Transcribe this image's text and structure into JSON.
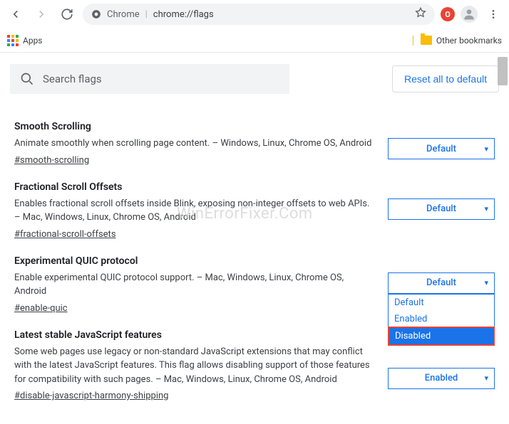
{
  "browser": {
    "omnibox_prefix": "Chrome",
    "omnibox_url": "chrome://flags",
    "apps_label": "Apps",
    "other_bookmarks": "Other bookmarks"
  },
  "header": {
    "search_placeholder": "Search flags",
    "reset_label": "Reset all to default"
  },
  "flags": [
    {
      "title": "Smooth Scrolling",
      "desc": "Animate smoothly when scrolling page content. – Windows, Linux, Chrome OS, Android",
      "hash": "#smooth-scrolling",
      "value": "Default",
      "open": false
    },
    {
      "title": "Fractional Scroll Offsets",
      "desc": "Enables fractional scroll offsets inside Blink, exposing non-integer offsets to web APIs. – Mac, Windows, Linux, Chrome OS, Android",
      "hash": "#fractional-scroll-offsets",
      "value": "Default",
      "open": false
    },
    {
      "title": "Experimental QUIC protocol",
      "desc": "Enable experimental QUIC protocol support. – Mac, Windows, Linux, Chrome OS, Android",
      "hash": "#enable-quic",
      "value": "Default",
      "open": true,
      "options": [
        "Default",
        "Enabled",
        "Disabled"
      ],
      "highlighted": "Disabled"
    },
    {
      "title": "Latest stable JavaScript features",
      "desc": "Some web pages use legacy or non-standard JavaScript extensions that may conflict with the latest JavaScript features. This flag allows disabling support of those features for compatibility with such pages. – Mac, Windows, Linux, Chrome OS, Android",
      "hash": "#disable-javascript-harmony-shipping",
      "value": "Enabled",
      "open": false
    }
  ],
  "watermark": "WinErrorFixer.Com"
}
